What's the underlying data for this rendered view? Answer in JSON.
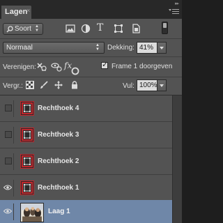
{
  "panel": {
    "tab_label": "Lagen",
    "tab_close": "×",
    "collapse": "▸▸"
  },
  "filter": {
    "kind_label": "Soort",
    "icons": [
      "image-filter-icon",
      "adjustment-filter-icon",
      "type-filter-icon",
      "shape-filter-icon",
      "smart-object-filter-icon"
    ],
    "type_glyph": "T"
  },
  "blend": {
    "mode": "Normaal",
    "opacity_label": "Dekking:",
    "opacity_value": "41%"
  },
  "unify": {
    "label": "Verenigen:",
    "fx": "fx",
    "propagate_label": "Frame 1 doorgeven",
    "propagate_checked": true
  },
  "lock": {
    "label": "Vergr.:",
    "fill_label": "Vul:",
    "fill_value": "100%"
  },
  "layers": [
    {
      "name": "Rechthoek 4",
      "visible": false,
      "type": "shape"
    },
    {
      "name": "Rechthoek 3",
      "visible": false,
      "type": "shape"
    },
    {
      "name": "Rechthoek 2",
      "visible": false,
      "type": "shape"
    },
    {
      "name": "Rechthoek 1",
      "visible": true,
      "type": "shape"
    },
    {
      "name": "Laag 1",
      "visible": true,
      "type": "image",
      "selected": true
    }
  ],
  "colors": {
    "panel": "#535353",
    "selected": "#6f87a8",
    "shape_border": "#c1272d"
  }
}
